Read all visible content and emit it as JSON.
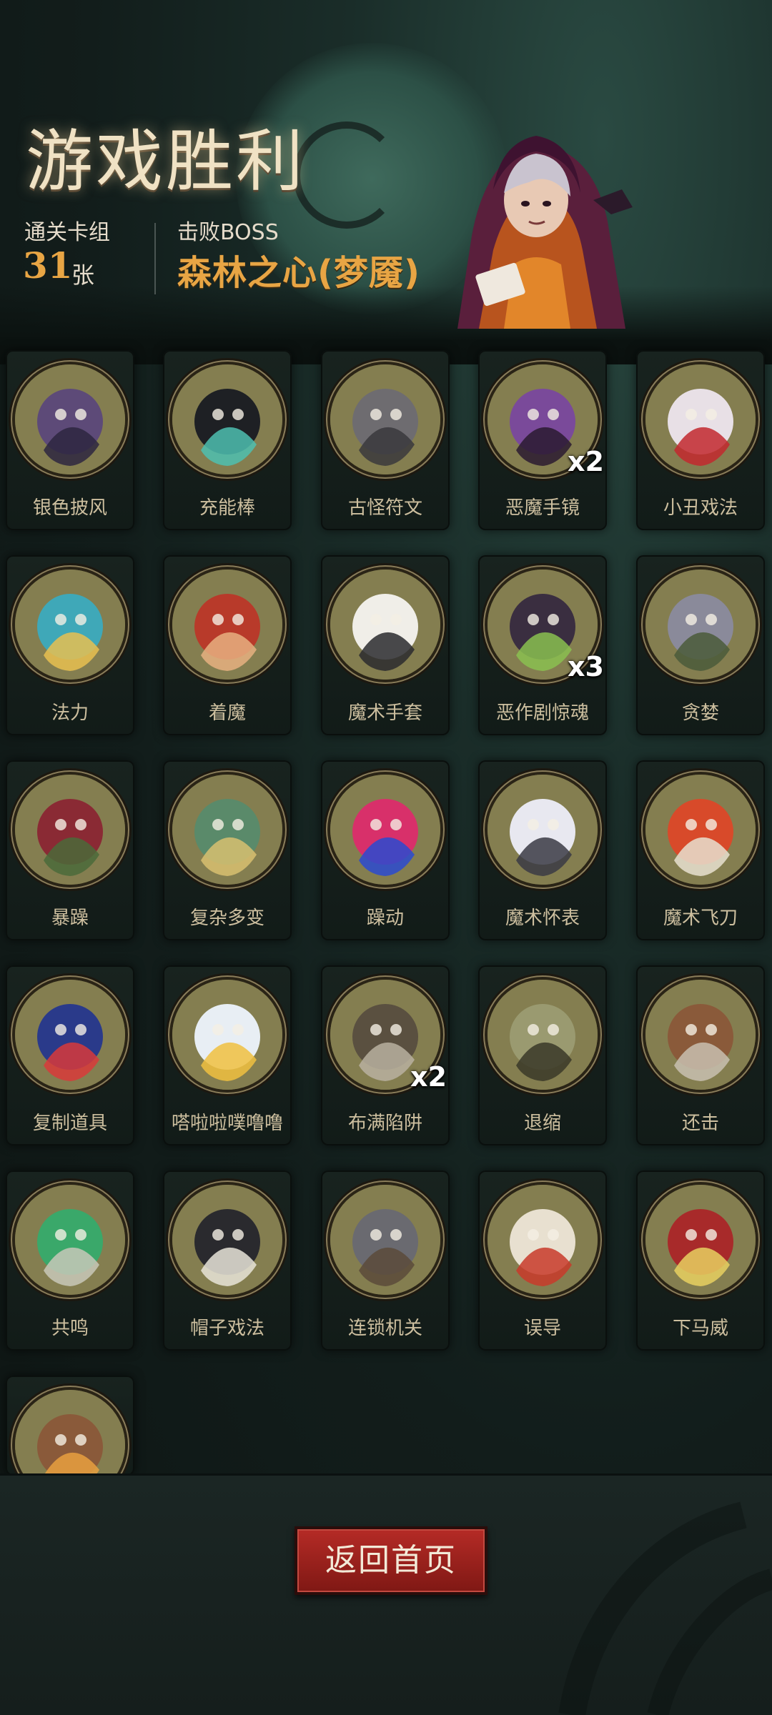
{
  "header": {
    "title": "游戏胜利",
    "deck_label": "通关卡组",
    "deck_count": "31",
    "deck_unit": "张",
    "boss_label": "击败BOSS",
    "boss_name": "森林之心(梦魇)"
  },
  "cards": [
    {
      "name": "银色披风",
      "icon": "cloak-icon"
    },
    {
      "name": "充能棒",
      "icon": "wand-icon"
    },
    {
      "name": "古怪符文",
      "icon": "rune-stone-icon"
    },
    {
      "name": "恶魔手镜",
      "icon": "demon-mirror-icon",
      "count": "x2"
    },
    {
      "name": "小丑戏法",
      "icon": "clown-icon"
    },
    {
      "name": "法力",
      "icon": "mana-orb-icon"
    },
    {
      "name": "着魔",
      "icon": "possessed-man-icon"
    },
    {
      "name": "魔术手套",
      "icon": "magic-glove-icon"
    },
    {
      "name": "恶作剧惊魂",
      "icon": "prank-cat-icon",
      "count": "x3"
    },
    {
      "name": "贪婪",
      "icon": "greedy-goblin-icon"
    },
    {
      "name": "暴躁",
      "icon": "angry-ogre-icon"
    },
    {
      "name": "复杂多变",
      "icon": "cube-cluster-icon"
    },
    {
      "name": "躁动",
      "icon": "restless-flame-icon"
    },
    {
      "name": "魔术怀表",
      "icon": "pocket-watch-icon"
    },
    {
      "name": "魔术飞刀",
      "icon": "knife-clown-icon"
    },
    {
      "name": "复制道具",
      "icon": "duplicate-icon"
    },
    {
      "name": "嗒啦啦噗噜噜",
      "icon": "robot-girl-icon"
    },
    {
      "name": "布满陷阱",
      "icon": "spike-trap-icon",
      "count": "x2"
    },
    {
      "name": "退缩",
      "icon": "retreat-icon"
    },
    {
      "name": "还击",
      "icon": "counterattack-icon"
    },
    {
      "name": "共鸣",
      "icon": "resonance-skulls-icon"
    },
    {
      "name": "帽子戏法",
      "icon": "top-hat-rabbit-icon"
    },
    {
      "name": "连锁机关",
      "icon": "chain-trap-icon"
    },
    {
      "name": "误导",
      "icon": "misdirection-skull-icon"
    },
    {
      "name": "下马威",
      "icon": "intimidation-icon"
    },
    {
      "name": "",
      "icon": "owl-icon"
    }
  ],
  "footer": {
    "return_label": "返回首页"
  },
  "colors": {
    "accent": "#e8a544",
    "title": "#f0e2c4",
    "button": "#a5231f",
    "coin": "#847e50"
  }
}
